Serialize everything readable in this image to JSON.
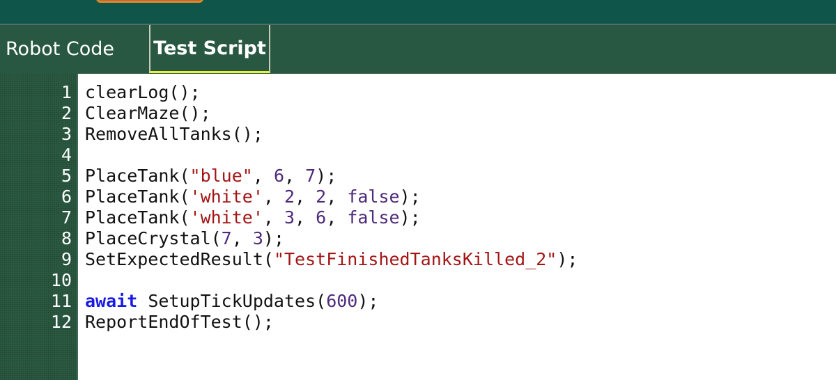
{
  "tabs": {
    "robot_code": "Robot Code",
    "test_script": "Test Script"
  },
  "line_numbers": [
    "1",
    "2",
    "3",
    "4",
    "5",
    "6",
    "7",
    "8",
    "9",
    "10",
    "11",
    "12"
  ],
  "code": {
    "l1": "clearLog();",
    "l2": "ClearMaze();",
    "l3": "RemoveAllTanks();",
    "l5": {
      "a": "PlaceTank(",
      "s1": "\"blue\"",
      "c1": ", ",
      "n1": "6",
      "c2": ", ",
      "n2": "7",
      "e": ");"
    },
    "l6": {
      "a": "PlaceTank(",
      "s1": "'white'",
      "c1": ", ",
      "n1": "2",
      "c2": ", ",
      "n2": "2",
      "c3": ", ",
      "b": "false",
      "e": ");"
    },
    "l7": {
      "a": "PlaceTank(",
      "s1": "'white'",
      "c1": ", ",
      "n1": "3",
      "c2": ", ",
      "n2": "6",
      "c3": ", ",
      "b": "false",
      "e": ");"
    },
    "l8": {
      "a": "PlaceCrystal(",
      "n1": "7",
      "c1": ", ",
      "n2": "3",
      "e": ");"
    },
    "l9": {
      "a": "SetExpectedResult(",
      "s1": "\"TestFinishedTanksKilled_2\"",
      "e": ");"
    },
    "l11": {
      "kw": "await",
      "a": " SetupTickUpdates(",
      "n1": "600",
      "e": ");"
    },
    "l12": "ReportEndOfTest();"
  },
  "colors": {
    "topbar": "#10554a",
    "tabbar": "#295842",
    "active_tab_underline": "#eef040",
    "string": "#a31515",
    "number": "#4e2a7a",
    "keyword": "#1a1ae6"
  }
}
